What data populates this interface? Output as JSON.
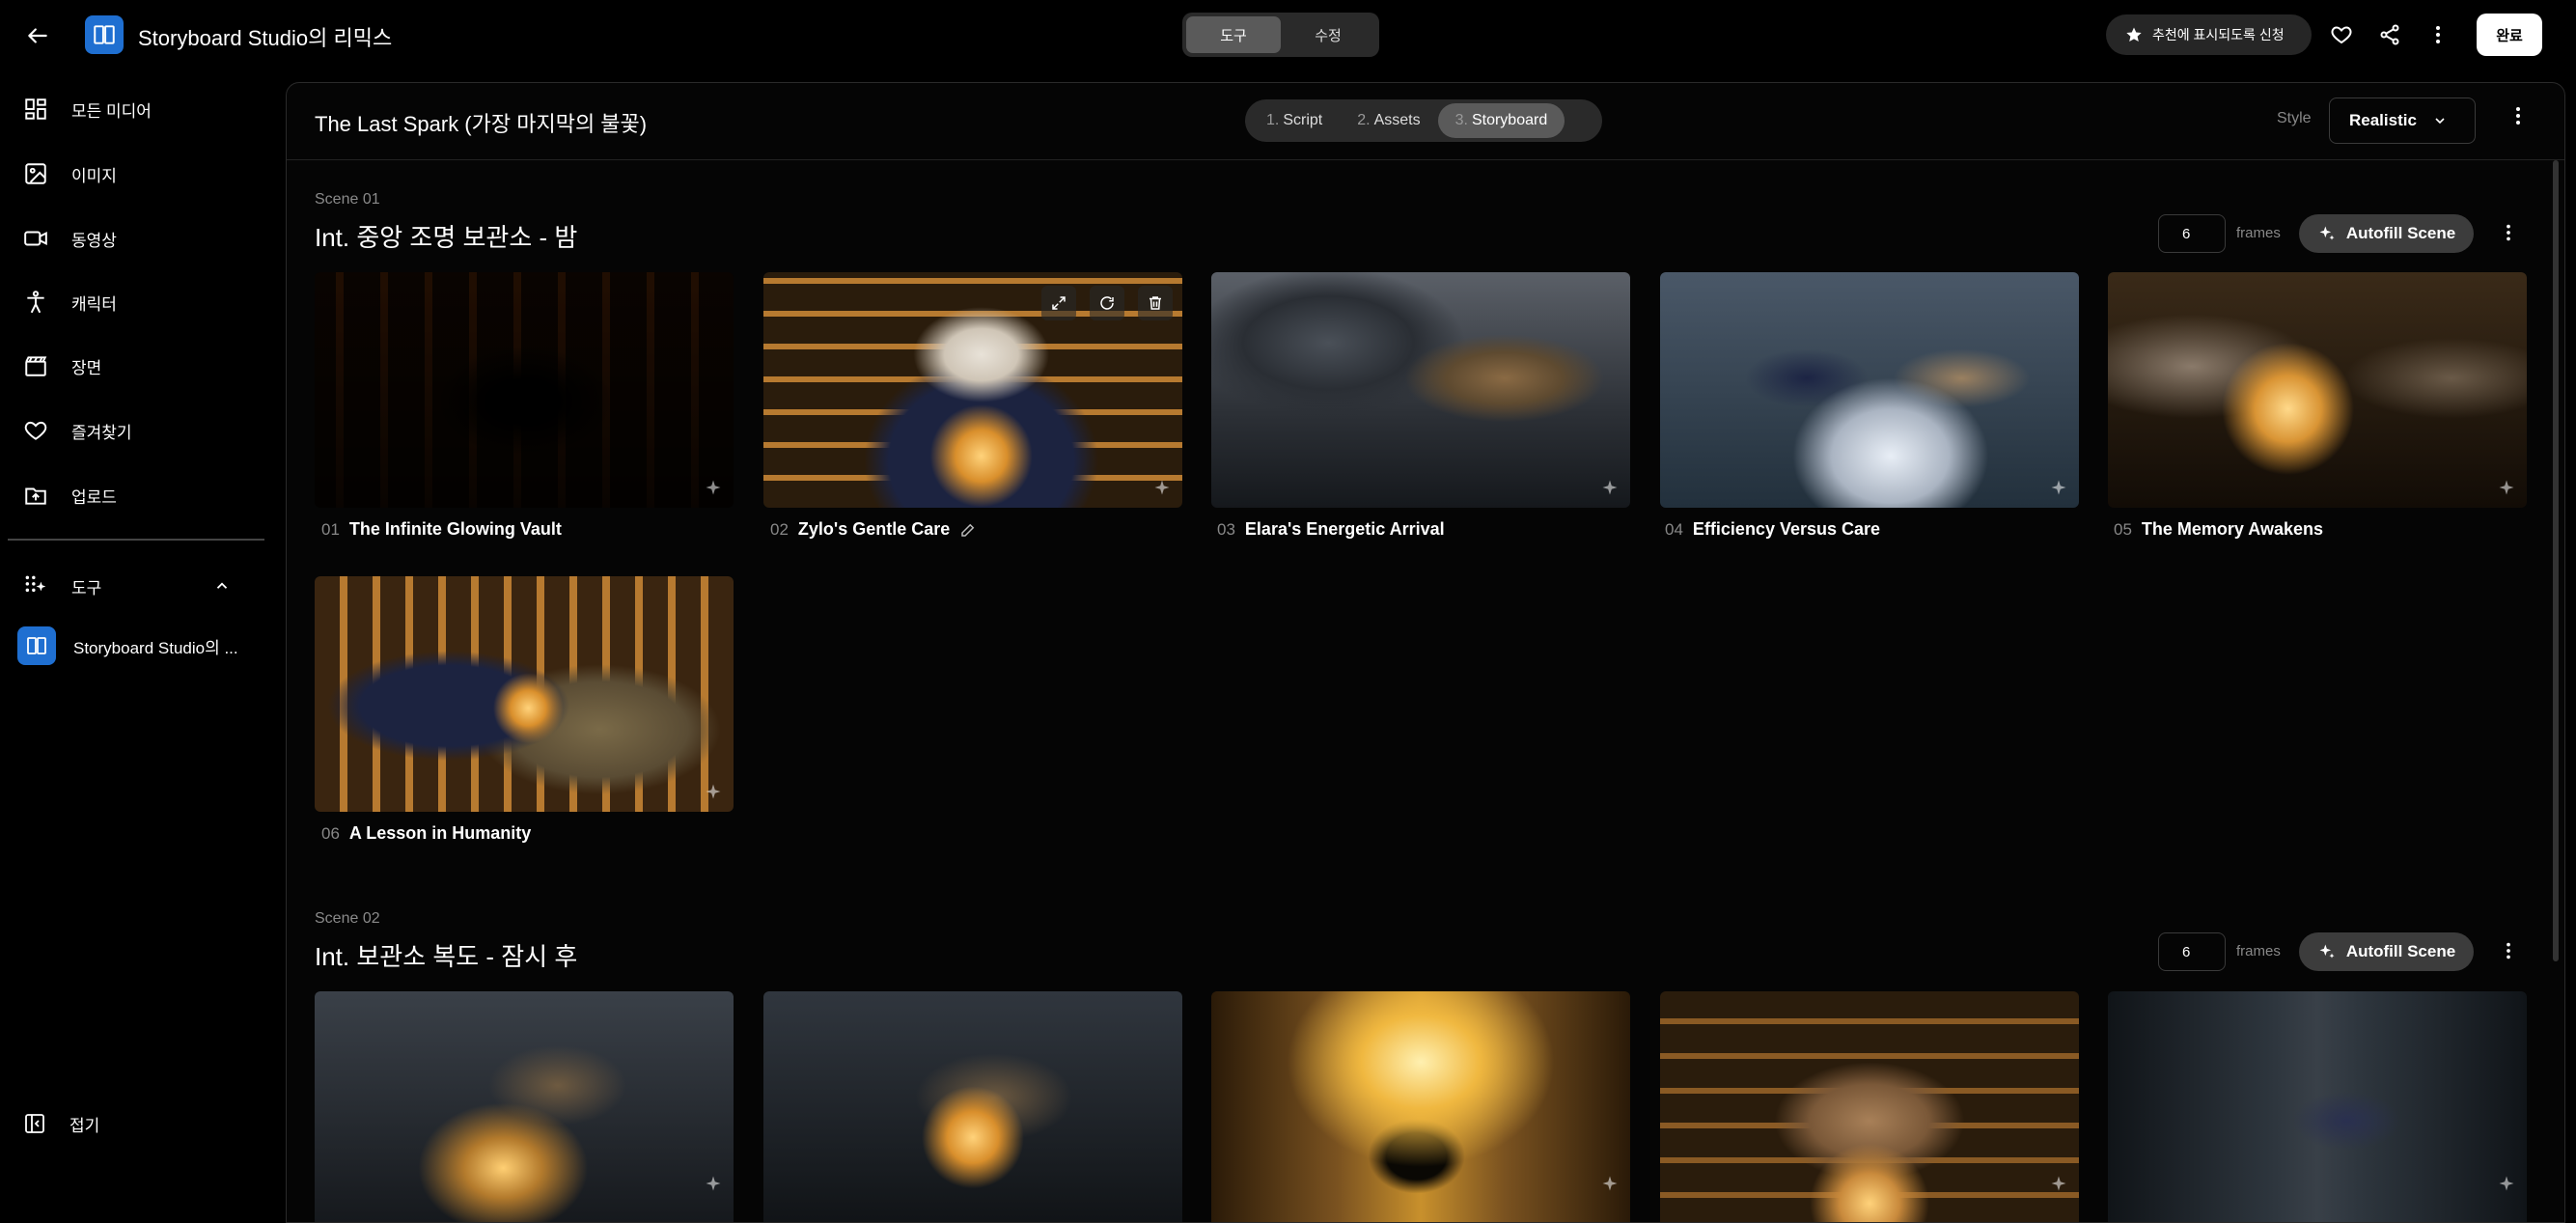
{
  "topbar": {
    "app_title": "Storyboard Studio의 리믹스",
    "mode_tabs": [
      "도구",
      "수정"
    ],
    "feature_request": "추천에 표시되도록 신청",
    "done": "완료"
  },
  "sidebar": {
    "items": [
      {
        "label": "모든 미디어",
        "icon": "grid-icon"
      },
      {
        "label": "이미지",
        "icon": "image-icon"
      },
      {
        "label": "동영상",
        "icon": "video-icon"
      },
      {
        "label": "캐릭터",
        "icon": "person-icon"
      },
      {
        "label": "장면",
        "icon": "clapper-icon"
      },
      {
        "label": "즐겨찾기",
        "icon": "heart-icon"
      },
      {
        "label": "업로드",
        "icon": "upload-folder-icon"
      }
    ],
    "tools_label": "도구",
    "tool_item": "Storyboard Studio의 ...",
    "collapse": "접기"
  },
  "main": {
    "project_title": "The Last Spark (가장 마지막의 불꽃)",
    "steps": [
      {
        "num": "1.",
        "label": "Script"
      },
      {
        "num": "2.",
        "label": "Assets"
      },
      {
        "num": "3.",
        "label": "Storyboard"
      }
    ],
    "style_label": "Style",
    "style_value": "Realistic"
  },
  "scenes": [
    {
      "label": "Scene 01",
      "title": "Int. 중앙 조명 보관소 - 밤",
      "frames_count": "6",
      "frames_label": "frames",
      "autofill": "Autofill Scene",
      "frames": [
        {
          "num": "01",
          "title": "The Infinite Glowing Vault"
        },
        {
          "num": "02",
          "title": "Zylo's Gentle Care"
        },
        {
          "num": "03",
          "title": "Elara's Energetic Arrival"
        },
        {
          "num": "04",
          "title": "Efficiency Versus Care"
        },
        {
          "num": "05",
          "title": "The Memory Awakens"
        },
        {
          "num": "06",
          "title": "A Lesson in Humanity"
        }
      ]
    },
    {
      "label": "Scene 02",
      "title": "Int. 보관소 복도 - 잠시 후",
      "frames_count": "6",
      "frames_label": "frames",
      "autofill": "Autofill Scene"
    }
  ]
}
